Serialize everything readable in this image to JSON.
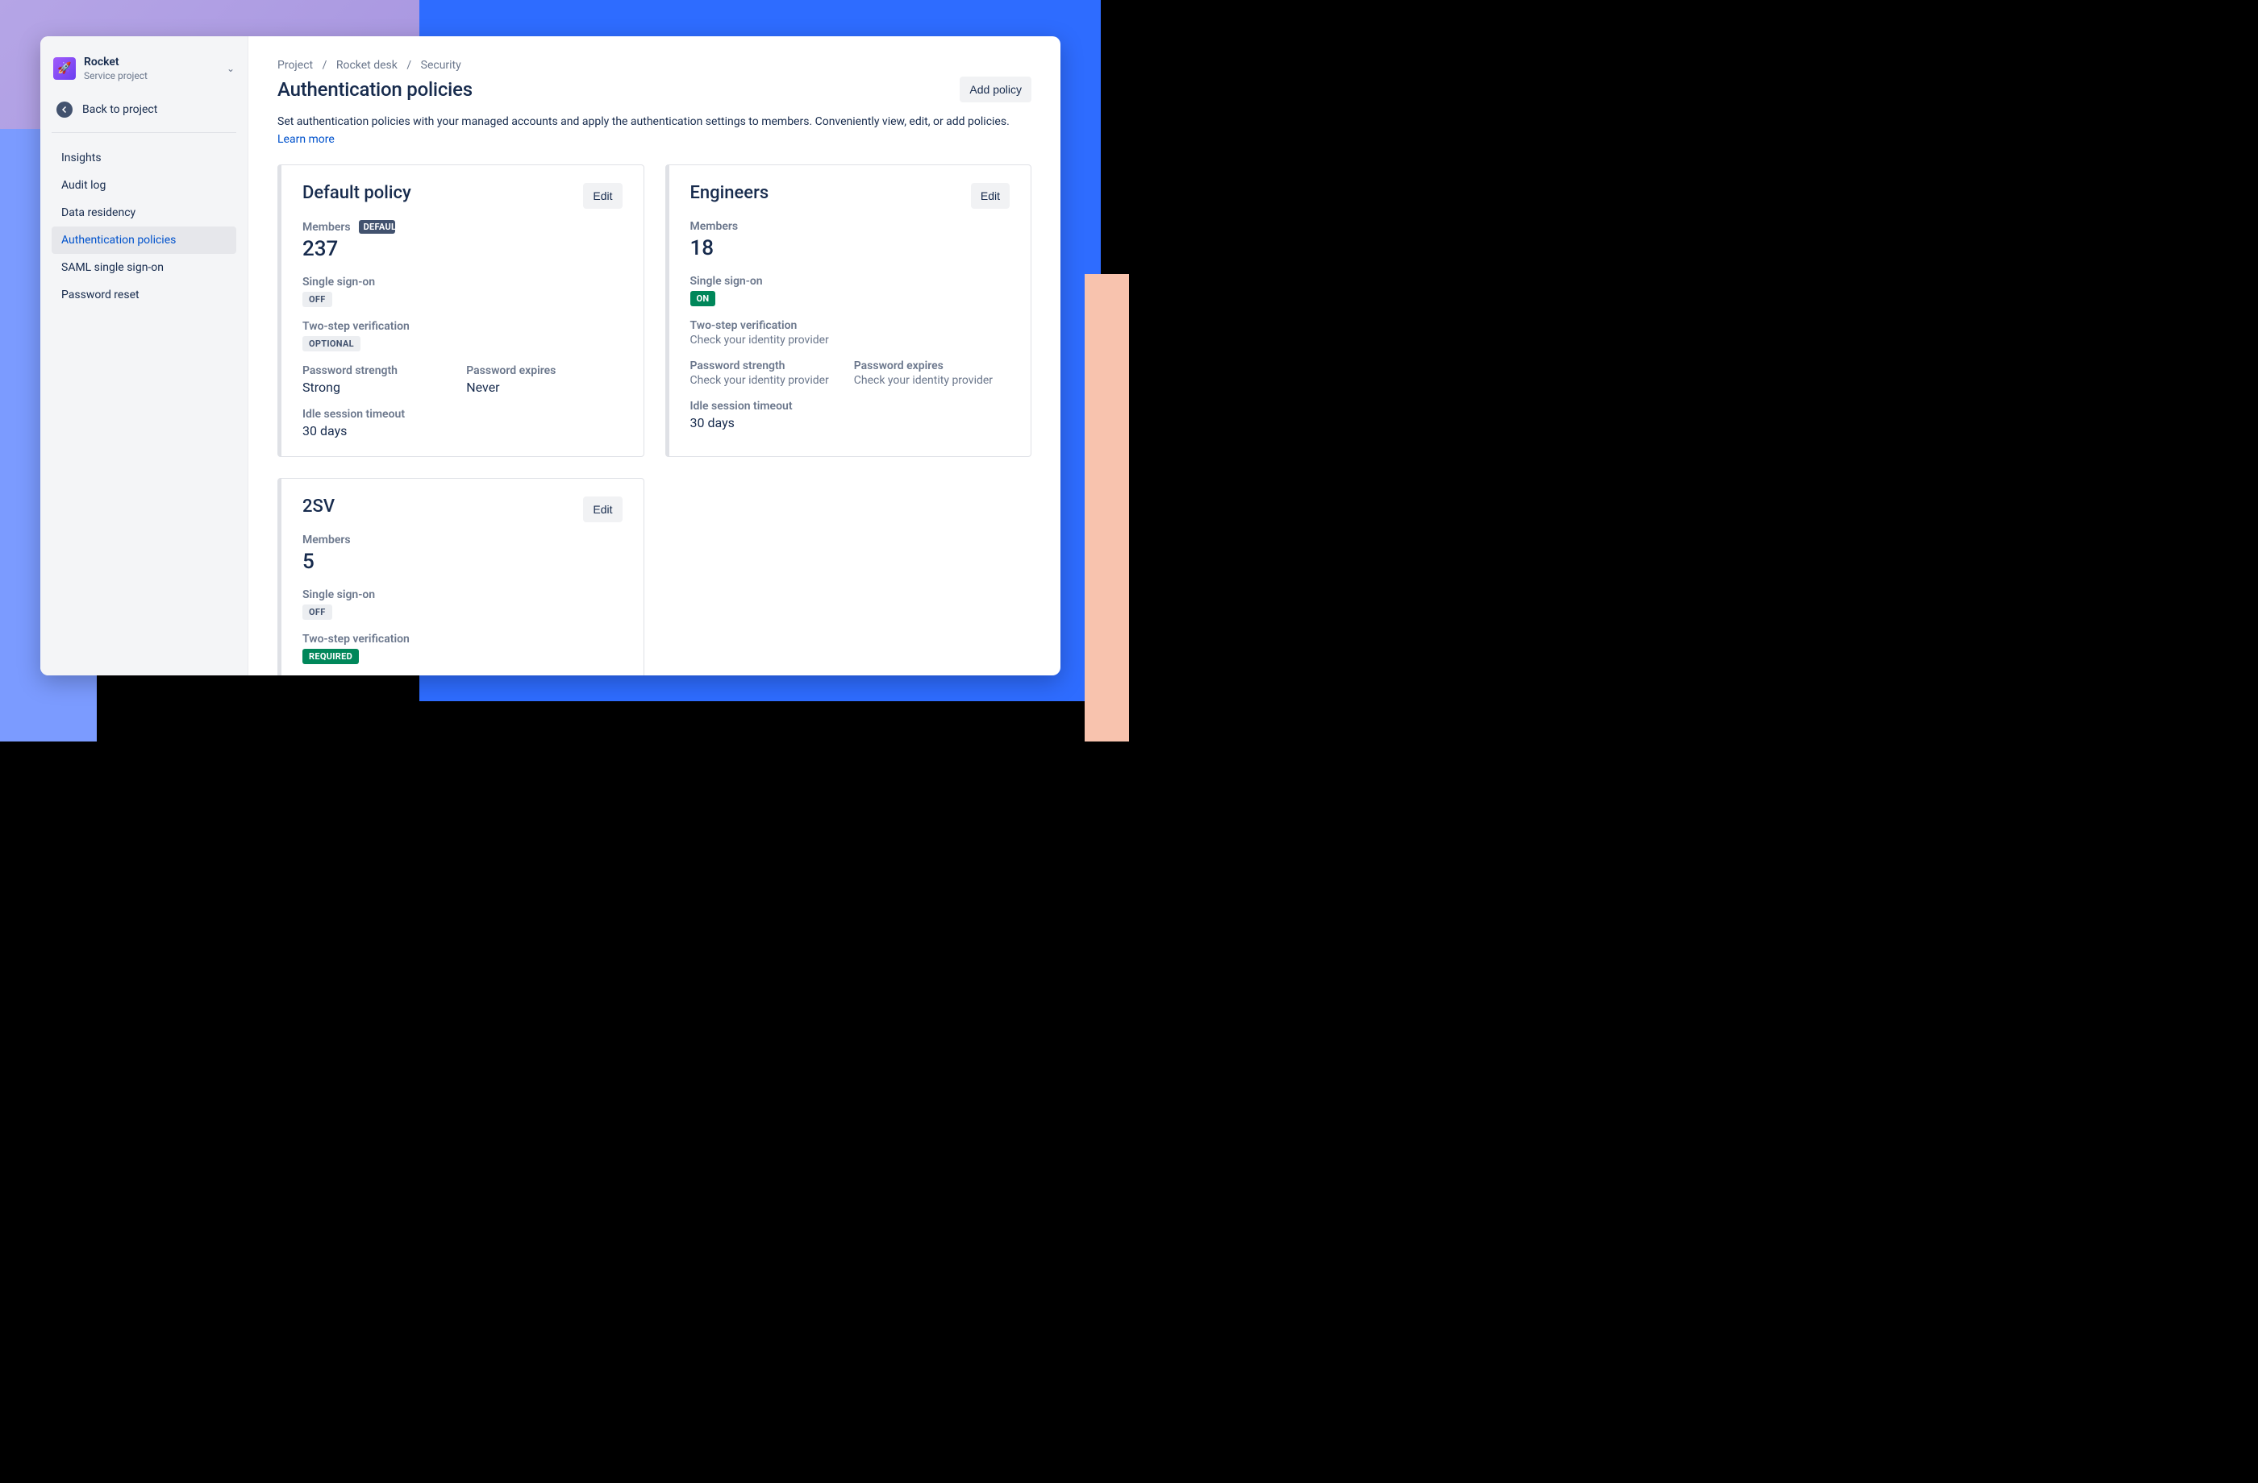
{
  "sidebar": {
    "project_name": "Rocket",
    "project_type": "Service project",
    "project_icon": "🚀",
    "back_label": "Back to project",
    "nav": [
      {
        "label": "Insights"
      },
      {
        "label": "Audit log"
      },
      {
        "label": "Data residency"
      },
      {
        "label": "Authentication policies",
        "active": true
      },
      {
        "label": "SAML single sign-on"
      },
      {
        "label": "Password reset"
      }
    ]
  },
  "breadcrumb": [
    "Project",
    "Rocket desk",
    "Security"
  ],
  "header": {
    "title": "Authentication policies",
    "add_button": "Add policy"
  },
  "description": {
    "text": "Set authentication policies with your managed accounts and apply the authentication settings to members. Conveniently view, edit, or add policies. ",
    "link": "Learn more"
  },
  "labels": {
    "members": "Members",
    "edit": "Edit",
    "sso": "Single sign-on",
    "twosv": "Two-step verification",
    "pw_strength": "Password strength",
    "pw_expires": "Password expires",
    "idle": "Idle session timeout"
  },
  "policies": [
    {
      "name": "Default policy",
      "is_default": true,
      "default_badge": "DEFAULT",
      "members": 237,
      "sso": {
        "pill": "OFF",
        "pill_class": "pill-grey"
      },
      "twosv": {
        "pill": "OPTIONAL",
        "pill_class": "pill-grey"
      },
      "pw_strength": "Strong",
      "pw_expires": "Never",
      "idle": "30 days",
      "idp_note": null
    },
    {
      "name": "Engineers",
      "is_default": false,
      "members": 18,
      "sso": {
        "pill": "ON",
        "pill_class": "pill-green"
      },
      "twosv": {
        "text": "Check your identity provider"
      },
      "pw_strength_note": "Check your identity provider",
      "pw_expires_note": "Check your identity provider",
      "idle": "30 days"
    },
    {
      "name": "2SV",
      "is_default": false,
      "members": 5,
      "sso": {
        "pill": "OFF",
        "pill_class": "pill-grey"
      },
      "twosv": {
        "pill": "REQUIRED",
        "pill_class": "pill-green"
      }
    }
  ]
}
